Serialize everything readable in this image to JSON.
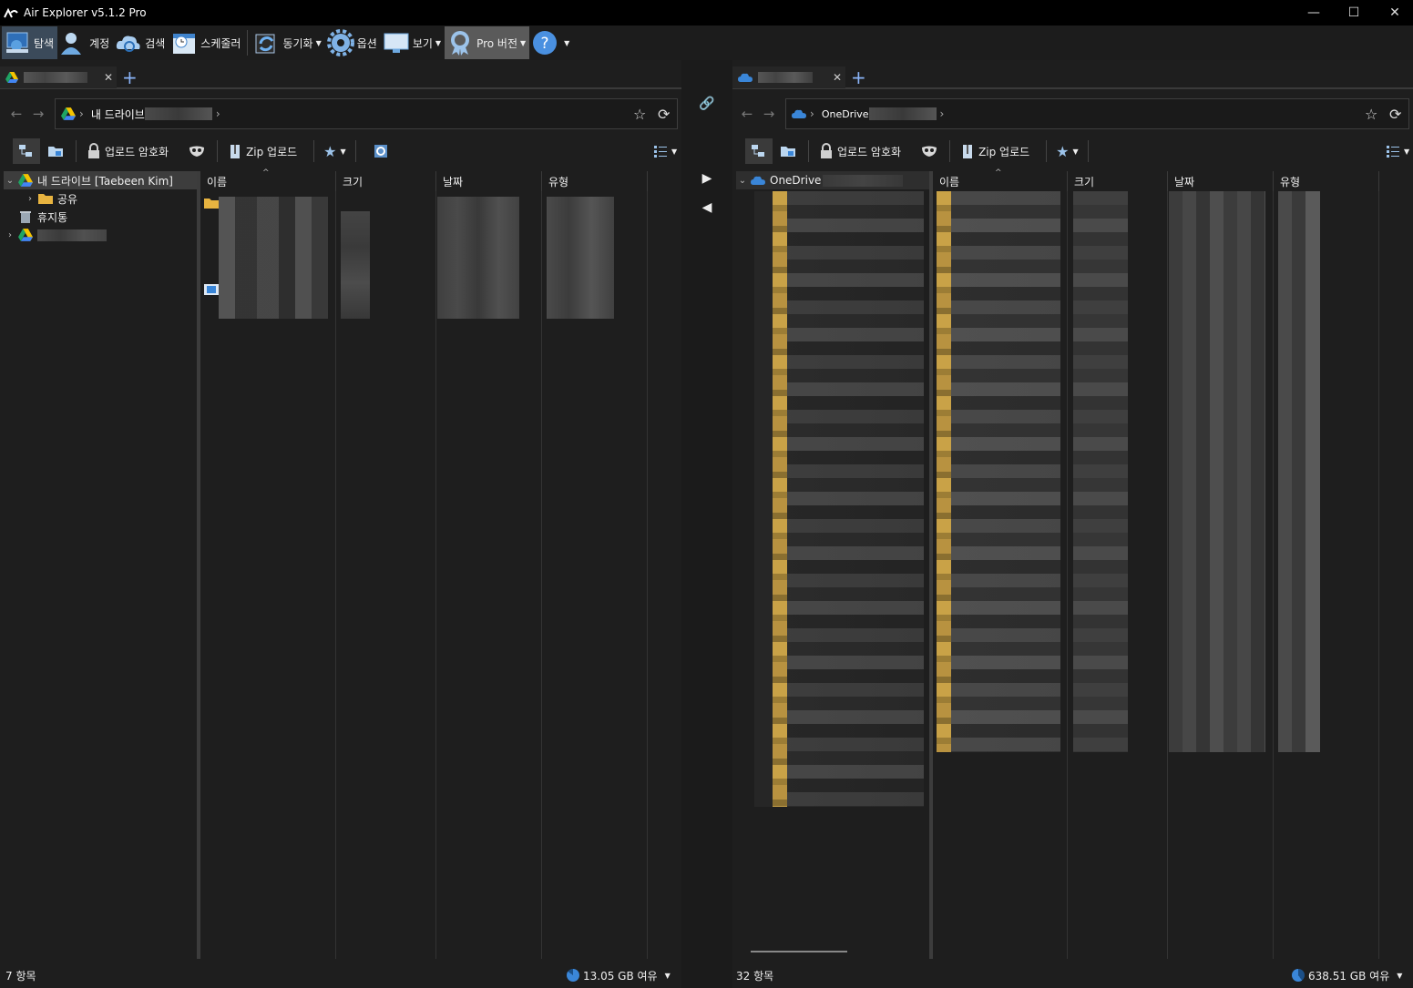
{
  "window": {
    "title": "Air Explorer v5.1.2 Pro"
  },
  "toolbar": {
    "explore": "탐색",
    "accounts": "계정",
    "search": "검색",
    "scheduler": "스케줄러",
    "sync": "동기화",
    "options": "옵션",
    "view": "보기",
    "pro": "Pro 버전"
  },
  "left": {
    "breadcrumb_root": "내 드라이브",
    "encrypt_upload": "업로드 암호화",
    "zip_upload": "Zip 업로드",
    "tree": {
      "root": "내 드라이브 [Taebeen Kim]",
      "shared": "공유",
      "trash": "휴지통"
    },
    "columns": [
      "이름",
      "크기",
      "날짜",
      "유형"
    ],
    "status_count": "7 항목",
    "status_free": "13.05 GB 여유"
  },
  "right": {
    "breadcrumb_root": "OneDrive",
    "encrypt_upload": "업로드 암호화",
    "zip_upload": "Zip 업로드",
    "tree": {
      "root": "OneDrive"
    },
    "columns": [
      "이름",
      "크기",
      "날짜",
      "유형"
    ],
    "status_count": "32 항목",
    "status_free": "638.51 GB 여유"
  },
  "colors": {
    "accent_blue": "#3a86d8",
    "folder_yellow": "#e8b440",
    "background": "#1e1e1e"
  },
  "icons": {
    "google_drive": "google-drive-icon",
    "onedrive": "onedrive-icon"
  }
}
